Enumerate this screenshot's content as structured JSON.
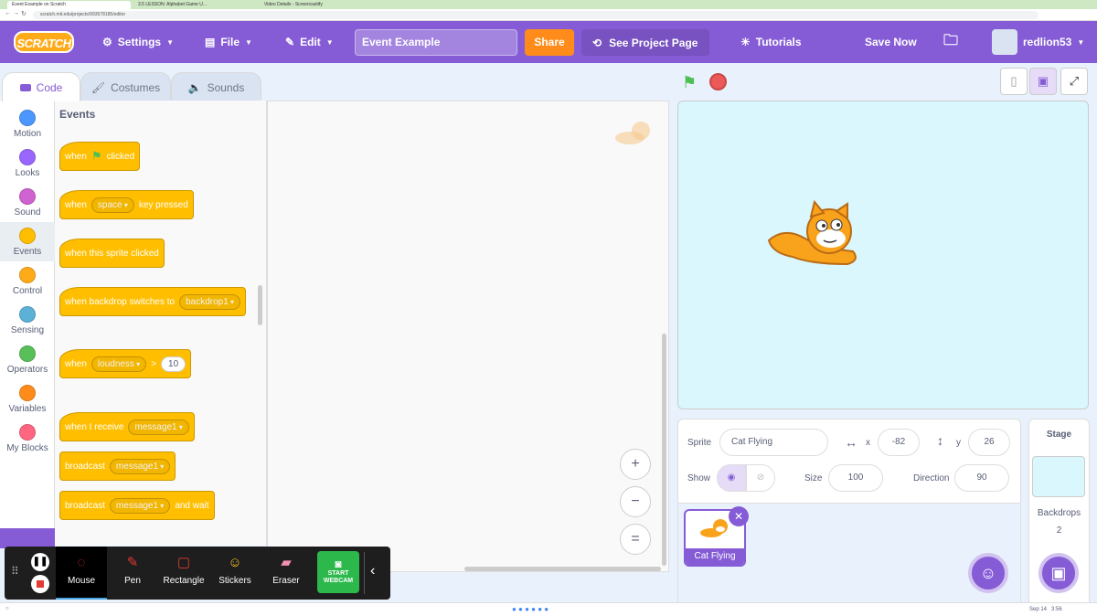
{
  "browser": {
    "tabs": [
      {
        "label": "Event Example on Scratch"
      },
      {
        "label": "3.5 LESSON: Alphabet Game U..."
      },
      {
        "label": "Video Details - Screencastify"
      }
    ],
    "url": "scratch.mit.edu/projects/993578185/editor"
  },
  "menubar": {
    "logo": "SCRATCH",
    "settings": "Settings",
    "file": "File",
    "edit": "Edit",
    "project_title": "Event Example",
    "share": "Share",
    "see_project_page": "See Project Page",
    "tutorials": "Tutorials",
    "save_now": "Save Now",
    "username": "redlion53"
  },
  "editor_tabs": {
    "code": "Code",
    "costumes": "Costumes",
    "sounds": "Sounds"
  },
  "categories": [
    {
      "label": "Motion",
      "color": "#4c97ff"
    },
    {
      "label": "Looks",
      "color": "#9966ff"
    },
    {
      "label": "Sound",
      "color": "#cf63cf"
    },
    {
      "label": "Events",
      "color": "#ffbf00"
    },
    {
      "label": "Control",
      "color": "#ffab19"
    },
    {
      "label": "Sensing",
      "color": "#5cb1d6"
    },
    {
      "label": "Operators",
      "color": "#59c059"
    },
    {
      "label": "Variables",
      "color": "#ff8c1a"
    },
    {
      "label": "My Blocks",
      "color": "#ff6680"
    }
  ],
  "palette": {
    "title": "Events",
    "b1_a": "when",
    "b1_b": "clicked",
    "b2_a": "when",
    "b2_drop": "space",
    "b2_b": "key pressed",
    "b3": "when this sprite clicked",
    "b4_a": "when backdrop switches to",
    "b4_drop": "backdrop1",
    "b5_a": "when",
    "b5_drop": "loudness",
    "b5_op": ">",
    "b5_num": "10",
    "b6_a": "when I receive",
    "b6_drop": "message1",
    "b7_a": "broadcast",
    "b7_drop": "message1",
    "b8_a": "broadcast",
    "b8_drop": "message1",
    "b8_b": "and wait"
  },
  "zoom": {
    "in": "+",
    "out": "−",
    "reset": "="
  },
  "sprite_info": {
    "sprite_label": "Sprite",
    "sprite_name": "Cat Flying",
    "x_label": "x",
    "x_value": "-82",
    "y_label": "y",
    "y_value": "26",
    "show_label": "Show",
    "size_label": "Size",
    "size_value": "100",
    "direction_label": "Direction",
    "direction_value": "90"
  },
  "sprite_list": [
    {
      "name": "Cat Flying"
    }
  ],
  "stage_panel": {
    "title": "Stage",
    "backdrops_label": "Backdrops",
    "backdrops_count": "2"
  },
  "recorder": {
    "tools": [
      "Mouse",
      "Pen",
      "Rectangle",
      "Stickers",
      "Eraser"
    ],
    "webcam": "START WEBCAM"
  },
  "taskbar": {
    "date": "Sep 14",
    "time": "3:56"
  }
}
